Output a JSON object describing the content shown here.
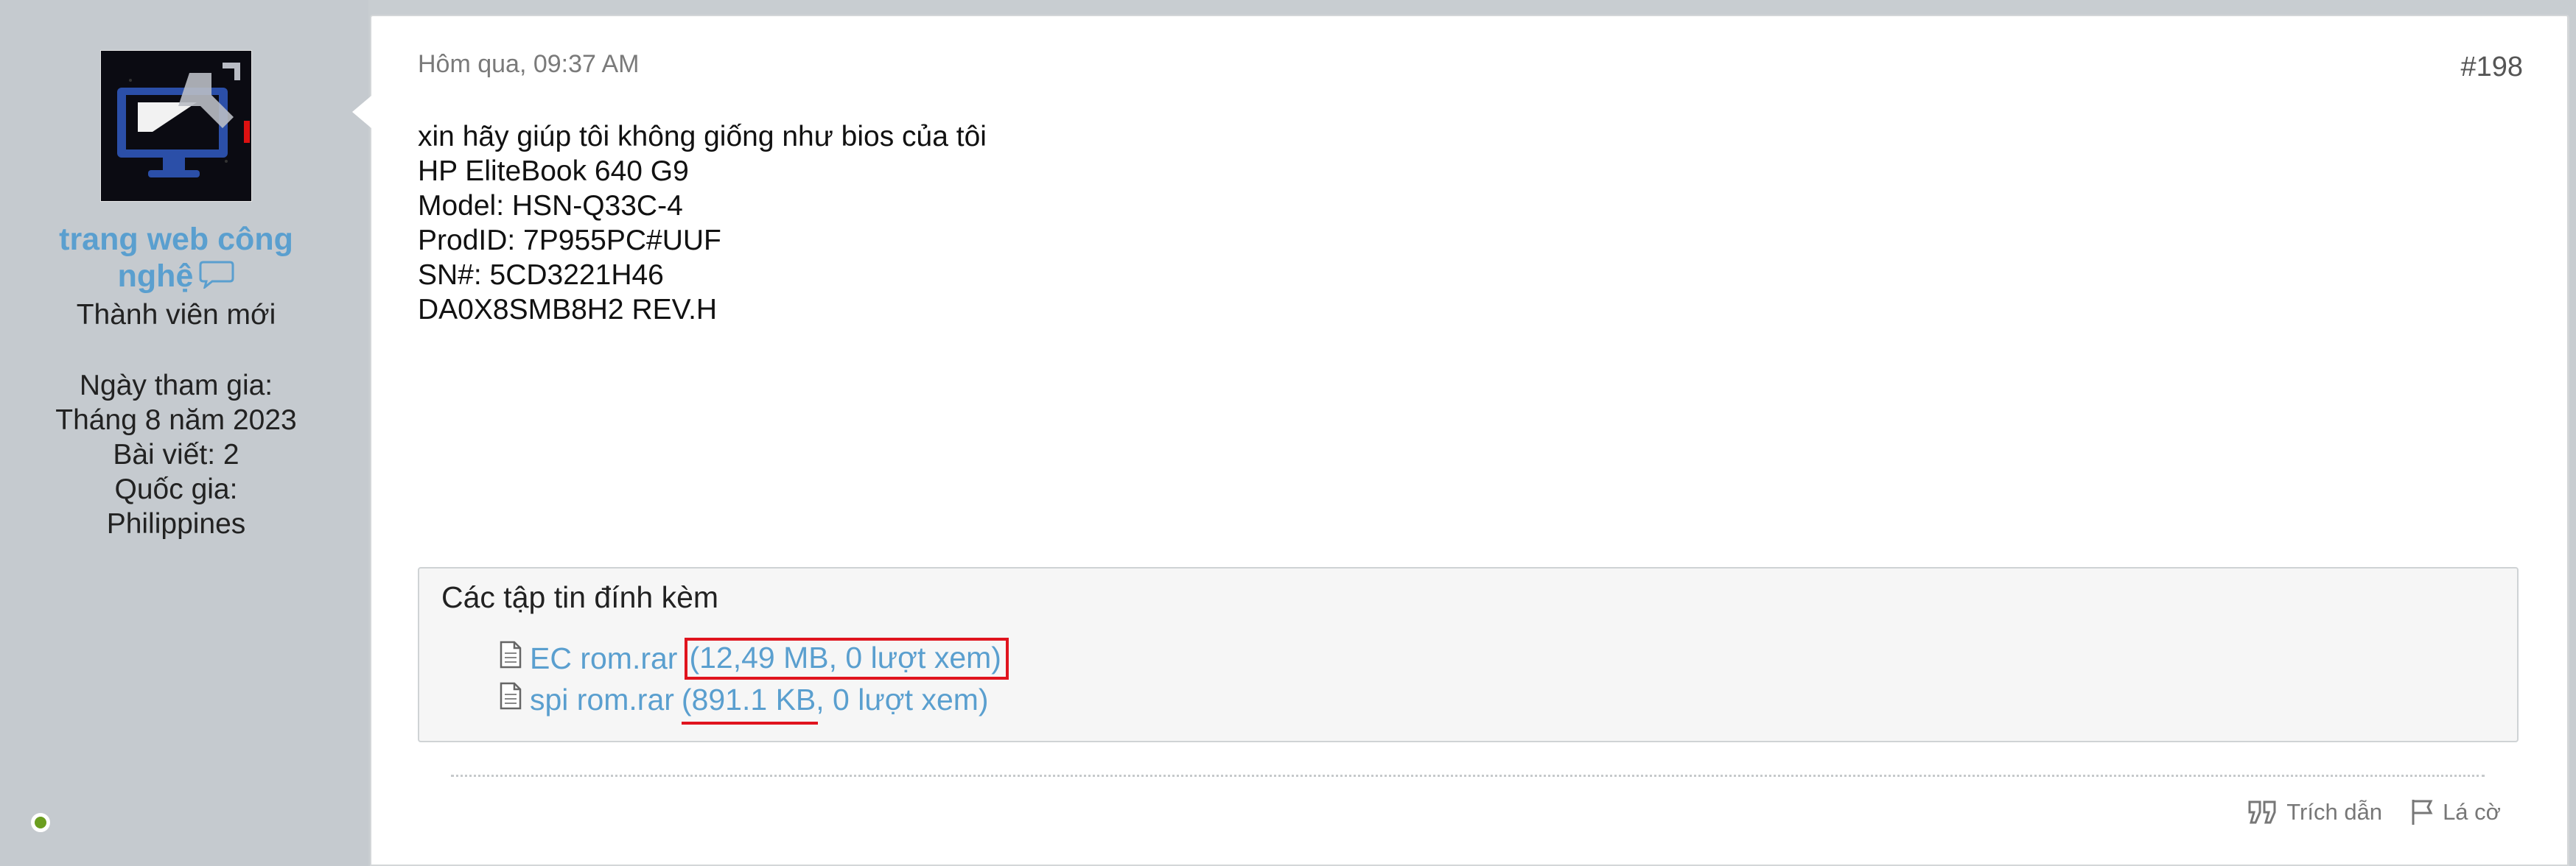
{
  "user": {
    "name": "trang web công nghệ",
    "title": "Thành viên mới",
    "joined_label": "Ngày tham gia:",
    "joined_value": "Tháng 8 năm 2023",
    "posts": "Bài viết: 2",
    "country_label": "Quốc gia:",
    "country_value": "Philippines",
    "online_color": "#6b9e1f"
  },
  "post": {
    "date": "Hôm qua, 09:37 AM",
    "number": "#198",
    "lines": [
      "xin hãy giúp tôi không giống như bios của tôi",
      "HP EliteBook 640 G9",
      "Model: HSN-Q33C-4",
      "ProdID: 7P955PC#UUF",
      "SN#: 5CD3221H46",
      "DA0X8SMB8H2 REV.H"
    ]
  },
  "attachments": {
    "title": "Các tập tin đính kèm",
    "files": [
      {
        "name": "EC rom.rar",
        "meta": "(12,49 MB, 0 lượt xem)",
        "icon": "document-icon"
      },
      {
        "name": "spi rom.rar",
        "meta": "(891.1 KB, 0 lượt xem)",
        "icon": "document-icon"
      }
    ]
  },
  "actions": {
    "quote": "Trích dẫn",
    "flag": "Lá cờ"
  },
  "colors": {
    "link": "#5a9fcf",
    "highlight": "#e0141e",
    "sidebar": "#c5cacf"
  }
}
